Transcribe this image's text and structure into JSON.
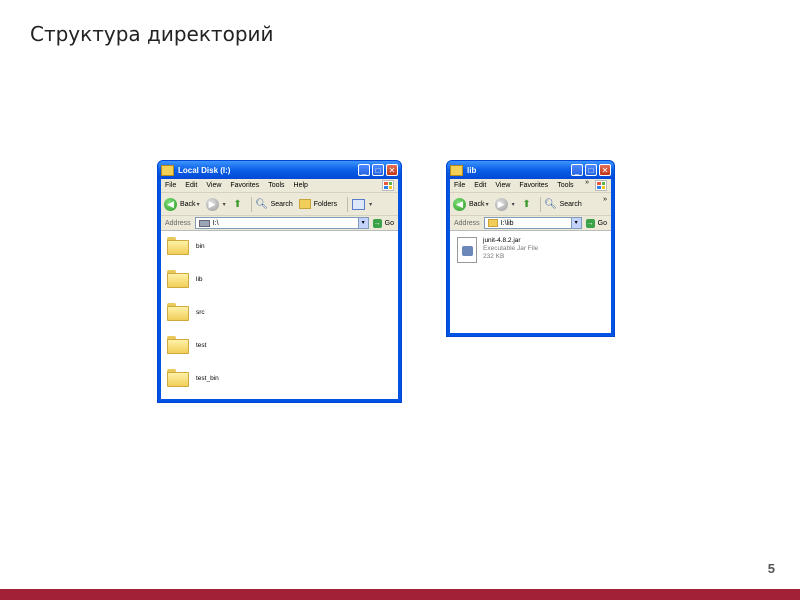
{
  "slide": {
    "title": "Структура директорий",
    "page_number": "5"
  },
  "window_left": {
    "title": "Local Disk (I:)",
    "menu": [
      "File",
      "Edit",
      "View",
      "Favorites",
      "Tools",
      "Help"
    ],
    "toolbar": {
      "back": "Back",
      "search": "Search",
      "folders": "Folders"
    },
    "address_label": "Address",
    "address_value": "I:\\",
    "go_label": "Go",
    "items": [
      "bin",
      "lib",
      "src",
      "test",
      "test_bin"
    ]
  },
  "window_right": {
    "title": "lib",
    "menu": [
      "File",
      "Edit",
      "View",
      "Favorites",
      "Tools"
    ],
    "toolbar": {
      "back": "Back",
      "search": "Search"
    },
    "overflow": "»",
    "address_label": "Address",
    "address_value": "I:\\lib",
    "go_label": "Go",
    "file": {
      "name": "junit-4.8.2.jar",
      "type": "Executable Jar File",
      "size": "232 KB"
    }
  },
  "colors": {
    "accent_bar": "#a32136",
    "xp_title": "#0054e3"
  }
}
